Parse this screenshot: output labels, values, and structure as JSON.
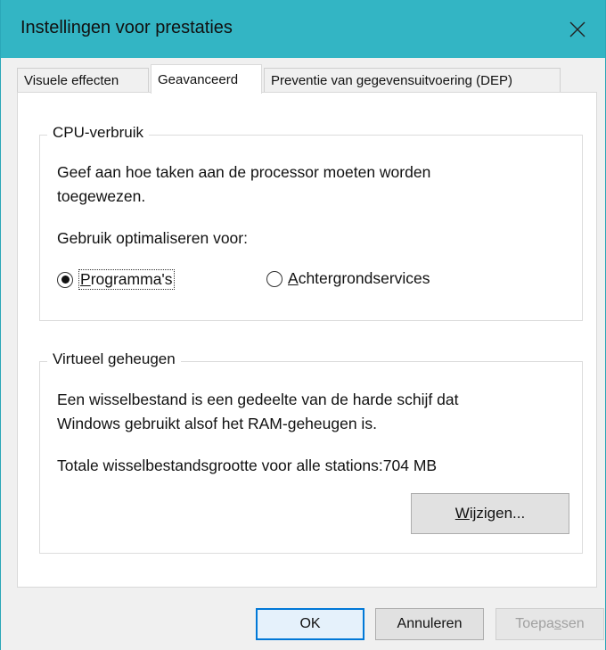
{
  "window": {
    "title": "Instellingen voor prestaties"
  },
  "tabs": [
    {
      "label": "Visuele effecten",
      "active": false
    },
    {
      "label": "Geavanceerd",
      "active": true
    },
    {
      "label": "Preventie van gegevensuitvoering (DEP)",
      "active": false
    }
  ],
  "cpu": {
    "legend": "CPU-verbruik",
    "description_line1": "Geef aan hoe taken aan de processor moeten worden",
    "description_line2": "toegewezen.",
    "optimize_label": "Gebruik optimaliseren voor:",
    "options": [
      {
        "label": "Programma's",
        "selected": true
      },
      {
        "label": "Achtergrondservices",
        "selected": false
      }
    ]
  },
  "virtual_memory": {
    "legend": "Virtueel geheugen",
    "description_line1": "Een wisselbestand is een gedeelte van de harde schijf dat",
    "description_line2": "Windows gebruikt alsof het RAM-geheugen is.",
    "total_label": "Totale wisselbestandsgrootte voor alle stations:",
    "total_value": "704 MB",
    "change_button": "Wijzigen..."
  },
  "footer": {
    "ok": "OK",
    "cancel": "Annuleren",
    "apply": "Toepassen"
  },
  "colors": {
    "titlebar": "#33b5c4",
    "primary_border": "#0078d7"
  },
  "icons": {
    "close": "close-icon"
  }
}
